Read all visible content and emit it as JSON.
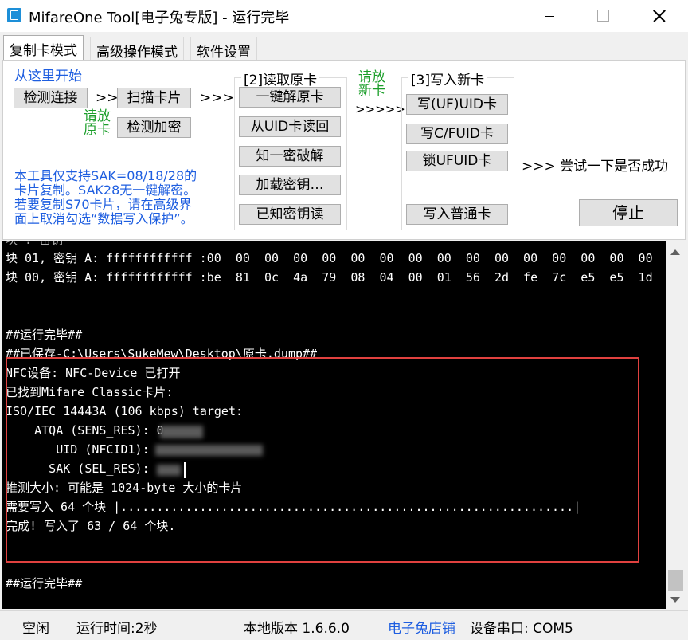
{
  "window": {
    "title": "MifareOne Tool[电子兔专版] - 运行完毕"
  },
  "tabs": [
    {
      "label": "复制卡模式"
    },
    {
      "label": "高级操作模式"
    },
    {
      "label": "软件设置"
    }
  ],
  "copy_mode": {
    "start_label": "从这里开始",
    "detect_connection": "检测连接",
    "arrow1": ">>",
    "scan_card": "扫描卡片",
    "arrow2": ">>>",
    "place_original_line1": "请放",
    "place_original_line2": "原卡",
    "detect_encryption": "检测加密",
    "read_group_title": "[2]读取原卡",
    "one_click_decrypt": "一键解原卡",
    "read_from_uid": "从UID卡读回",
    "known_key_crack": "知一密破解",
    "load_keys": "加载密钥…",
    "known_key_read": "已知密钥读",
    "place_new_line1": "请放",
    "place_new_line2": "新卡",
    "arrow3": ">>>>>",
    "write_group_title": "[3]写入新卡",
    "write_uid": "写(UF)UID卡",
    "write_cfuid": "写C/FUID卡",
    "lock_ufuid": "锁UFUID卡",
    "write_normal": "写入普通卡",
    "try_success": ">>> 尝试一下是否成功",
    "stop": "停止",
    "note": [
      "本工具仅支持SAK=08/18/28的",
      "卡片复制。SAK28无一键解密。",
      "若要复制S70卡片，请在高级界",
      "面上取消勾选“数据写入保护”。"
    ]
  },
  "console": {
    "lines": [
      "块 01, 密钥 A: ffffffffffff :00  00  00  00  00  00  00  00  00  00  00  00  00  00  00  00",
      "块 00, 密钥 A: ffffffffffff :be  81  0c  4a  79  08  04  00  01  56  2d  fe  7c  e5  e5  1d",
      "",
      "",
      "##运行完毕##",
      "##已保存-C:\\Users\\SukeMew\\Desktop\\原卡.dump##",
      "NFC设备: NFC-Device 已打开",
      "已找到Mifare Classic卡片:",
      "ISO/IEC 14443A (106 kbps) target:",
      "    ATQA (SENS_RES): 0",
      "       UID (NFCID1): ",
      "      SAK (SEL_RES): ",
      "推测大小: 可能是 1024-byte 大小的卡片",
      "需要写入 64 个块 |...............................................................|",
      "完成! 写入了 63 / 64 个块.",
      "",
      "",
      "##运行完毕##"
    ]
  },
  "status": {
    "state": "空闲",
    "run_time": "运行时间:2秒",
    "version": "本地版本 1.6.6.0",
    "shop_link": "电子兔店铺",
    "port": "设备串口: COM5"
  }
}
